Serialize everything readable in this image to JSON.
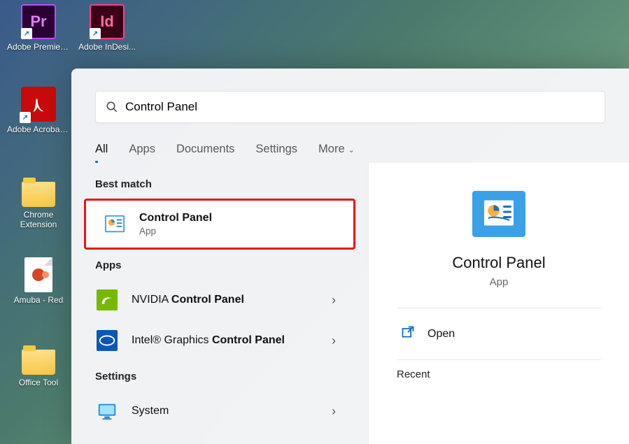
{
  "desktop": {
    "icons": [
      {
        "label": "Adobe Premiere Pr...",
        "initials": "Pr",
        "bg": "#2a0033",
        "fg": "#e07cff",
        "border": "#b84fff",
        "shortcut": true
      },
      {
        "label": "Adobe InDesi...",
        "initials": "Id",
        "bg": "#3b0016",
        "fg": "#ff6aa6",
        "border": "#ff3d8a",
        "shortcut": true
      },
      {
        "label": "Adobe Acrobat DC",
        "kind": "acrobat",
        "shortcut": true
      },
      {
        "label": "Chrome Extension",
        "kind": "folder"
      },
      {
        "label": "Amuba - Red",
        "kind": "pptdoc"
      },
      {
        "label": "Office Tool",
        "kind": "folder"
      }
    ]
  },
  "search": {
    "value": "Control Panel"
  },
  "tabs": {
    "items": [
      "All",
      "Apps",
      "Documents",
      "Settings",
      "More"
    ],
    "active": 0
  },
  "best_match_header": "Best match",
  "best_match": {
    "title": "Control Panel",
    "sub": "App"
  },
  "apps_header": "Apps",
  "apps": [
    {
      "prefix": "NVIDIA ",
      "bold": "Control Panel",
      "suffix": "",
      "icon": "nvidia"
    },
    {
      "prefix": "Intel® Graphics ",
      "bold": "Control Panel",
      "suffix": "",
      "icon": "intel"
    }
  ],
  "settings_header": "Settings",
  "settings": [
    {
      "title": "System",
      "icon": "monitor"
    }
  ],
  "details": {
    "title": "Control Panel",
    "sub": "App",
    "open_label": "Open",
    "recent_label": "Recent"
  }
}
